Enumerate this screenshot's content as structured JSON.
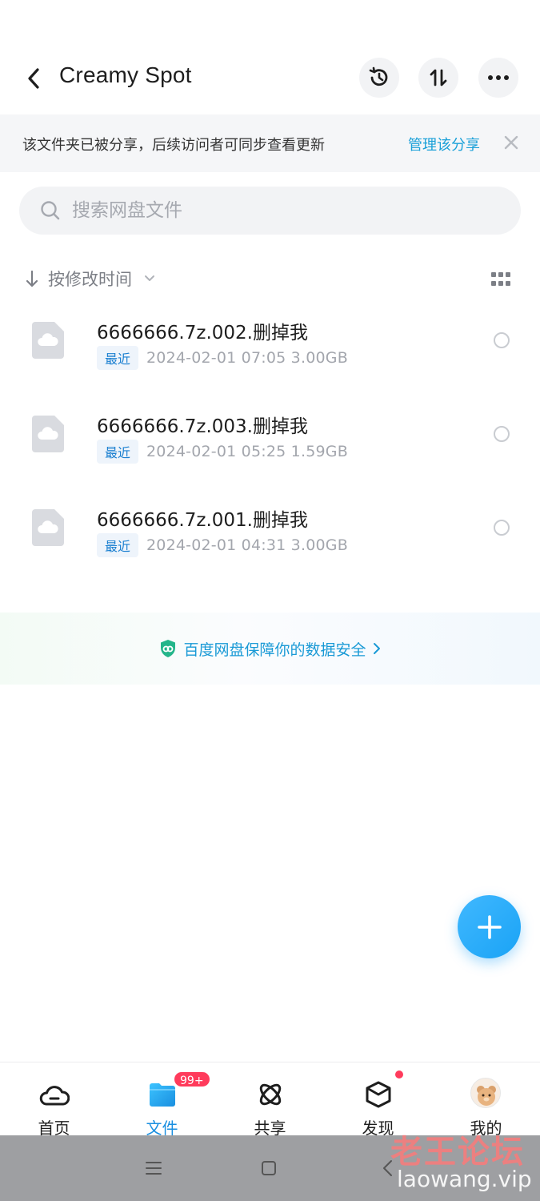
{
  "header": {
    "title": "Creamy Spot",
    "back_icon": "chevron-left-icon",
    "actions": [
      "history-icon",
      "sort-icon",
      "more-icon"
    ]
  },
  "share_banner": {
    "message": "该文件夹已被分享，后续访问者可同步查看更新",
    "manage_link": "管理该分享",
    "close_icon": "close-icon"
  },
  "search": {
    "placeholder": "搜索网盘文件",
    "value": ""
  },
  "sort": {
    "label": "按修改时间"
  },
  "files": [
    {
      "name": "6666666.7z.002.删掉我",
      "badge": "最近",
      "meta": "2024-02-01  07:05  3.00GB"
    },
    {
      "name": "6666666.7z.003.删掉我",
      "badge": "最近",
      "meta": "2024-02-01  05:25  1.59GB"
    },
    {
      "name": "6666666.7z.001.删掉我",
      "badge": "最近",
      "meta": "2024-02-01  04:31  3.00GB"
    }
  ],
  "security": {
    "text": "百度网盘保障你的数据安全"
  },
  "bottom_nav": {
    "items": [
      {
        "label": "首页",
        "icon": "cloud-home-icon"
      },
      {
        "label": "文件",
        "icon": "folder-icon"
      },
      {
        "label": "共享",
        "icon": "orbit-share-icon"
      },
      {
        "label": "发现",
        "icon": "cube-discover-icon"
      },
      {
        "label": "我的",
        "icon": "avatar"
      }
    ],
    "active_index": 1,
    "share_badge": "99+"
  },
  "watermark": {
    "cn": "老王论坛",
    "en": "laowang.vip"
  },
  "colors": {
    "accent": "#1a8fe0",
    "link": "#1aa0d8",
    "badge": "#ff3b5c"
  }
}
